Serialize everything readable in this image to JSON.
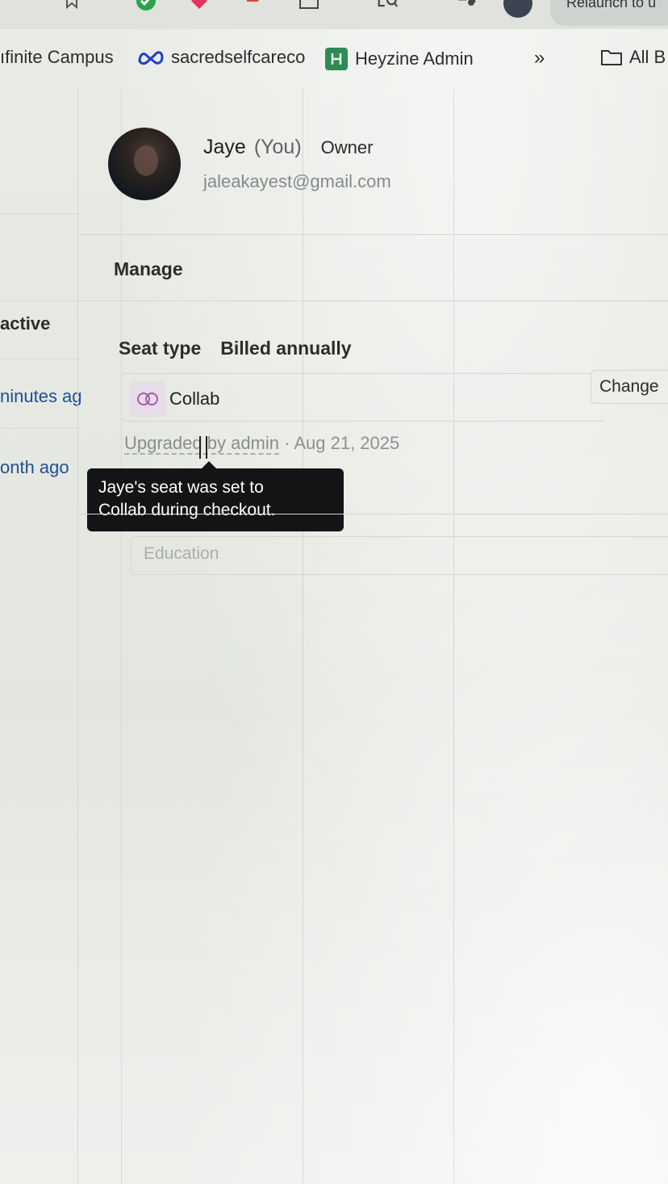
{
  "toolbar": {
    "icons": [
      "bookmark-icon",
      "check-shield-icon",
      "extension-icon",
      "flag-icon",
      "window-icon",
      "lens-icon",
      "media-icon",
      "profile-icon"
    ],
    "relaunch_label": "Relaunch to u"
  },
  "bookmarks": {
    "items": [
      {
        "label": "ıfinite Campus",
        "icon": "none"
      },
      {
        "label": "sacredselfcareco",
        "icon": "meta-icon"
      },
      {
        "label": "Heyzine Admin",
        "icon": "heyzine-icon"
      }
    ],
    "overflow_label": "»",
    "all_bookmarks_label": "All B"
  },
  "left_panel": {
    "status": "active",
    "time_1": "ninutes ag",
    "time_2": "onth ago"
  },
  "member": {
    "name": "Jaye",
    "you_tag": "(You)",
    "role": "Owner",
    "email": "jaleakayest@gmail.com"
  },
  "manage": {
    "heading": "Manage",
    "seat_type_label": "Seat type",
    "billing": "Billed annually",
    "seat_name": "Collab",
    "seat_icon": "collab-rings-icon",
    "change_label": "Change",
    "upgraded_text": "Upgraded by admin",
    "separator": " · ",
    "upgraded_date": "Aug 21, 2025",
    "tooltip_line1": "Jaye's seat was set to",
    "tooltip_line2": "Collab during checkout.",
    "education_placeholder": "Education"
  },
  "colors": {
    "background": "#e6e9e3",
    "tooltip_bg": "#121416",
    "collab_accent": "#a55ca8"
  }
}
